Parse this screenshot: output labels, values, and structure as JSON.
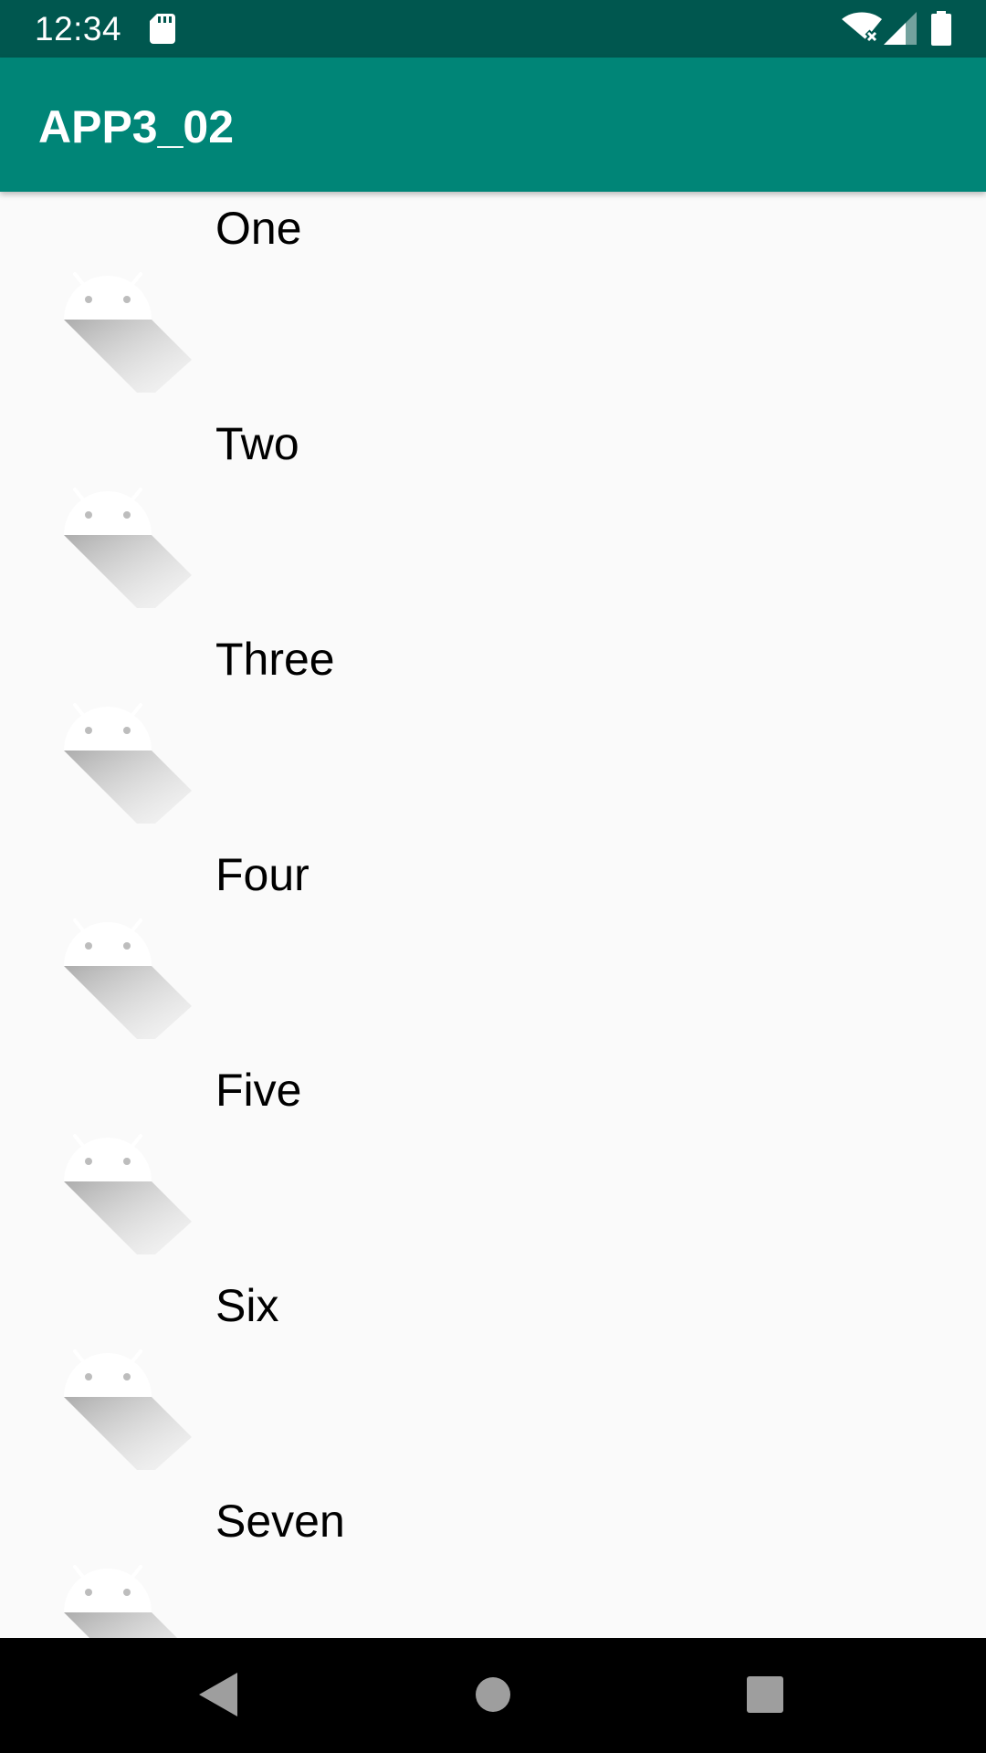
{
  "status_bar": {
    "time": "12:34",
    "icons": [
      "sd-card-icon",
      "wifi-off-icon",
      "signal-icon",
      "battery-icon"
    ]
  },
  "app_bar": {
    "title": "APP3_02"
  },
  "list": {
    "items": [
      {
        "label": "One",
        "icon": "android-icon"
      },
      {
        "label": "Two",
        "icon": "android-icon"
      },
      {
        "label": "Three",
        "icon": "android-icon"
      },
      {
        "label": "Four",
        "icon": "android-icon"
      },
      {
        "label": "Five",
        "icon": "android-icon"
      },
      {
        "label": "Six",
        "icon": "android-icon"
      },
      {
        "label": "Seven",
        "icon": "android-icon"
      }
    ]
  },
  "nav_bar": {
    "buttons": [
      "back-icon",
      "home-icon",
      "recents-icon"
    ]
  },
  "colors": {
    "status_bar": "#00574f",
    "app_bar": "#008577",
    "background": "#fafafa",
    "nav_bar": "#000000"
  }
}
